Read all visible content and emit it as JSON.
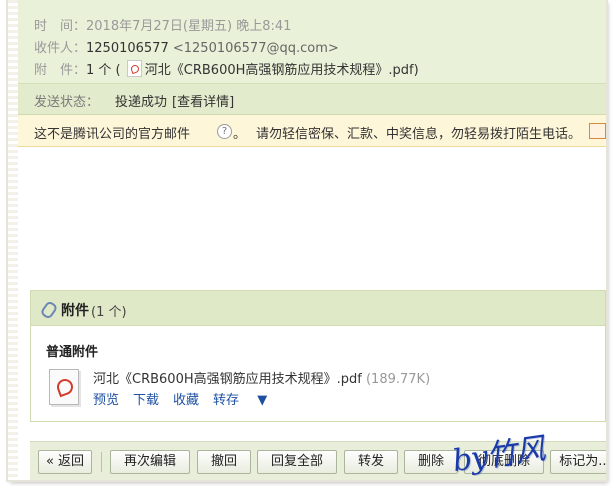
{
  "header": {
    "time_label": "时　间：",
    "time_value": "2018年7月27日(星期五) 晚上8:41",
    "recipient_label": "收件人：",
    "recipient_name": "1250106577",
    "recipient_email": "<1250106577@qq.com>",
    "attachment_label": "附　件：",
    "attachment_count_text": "1 个 (",
    "attachment_name": "河北《CRB600H高强钢筋应用技术规程》.pdf)"
  },
  "status": {
    "label": "发送状态：",
    "value": "投递成功",
    "details_link": "[查看详情]"
  },
  "warning": {
    "text": "这不是腾讯公司的官方邮件",
    "icon": "?",
    "period": "。",
    "advice": "请勿轻信密保、汇款、中奖信息，勿轻易拨打陌生电话。"
  },
  "attachments": {
    "title": "附件",
    "count": "(1 个)",
    "section_title": "普通附件",
    "file": {
      "name": "河北《CRB600H高强钢筋应用技术规程》.pdf",
      "size": "(189.77K)",
      "actions": [
        "预览",
        "下载",
        "收藏",
        "转存"
      ]
    }
  },
  "toolbar": {
    "back": "« 返回",
    "reedit": "再次编辑",
    "recall": "撤回",
    "reply_all": "回复全部",
    "forward": "转发",
    "delete": "删除",
    "delete_forever": "彻底删除",
    "mark_as": "标记为..."
  },
  "watermark": "by竹风",
  "colors": {
    "header_bg": "#eaf1d9",
    "warning_bg": "#fdf6d9",
    "link_blue": "#1e50a2",
    "signature_blue": "#1b3aa8"
  }
}
